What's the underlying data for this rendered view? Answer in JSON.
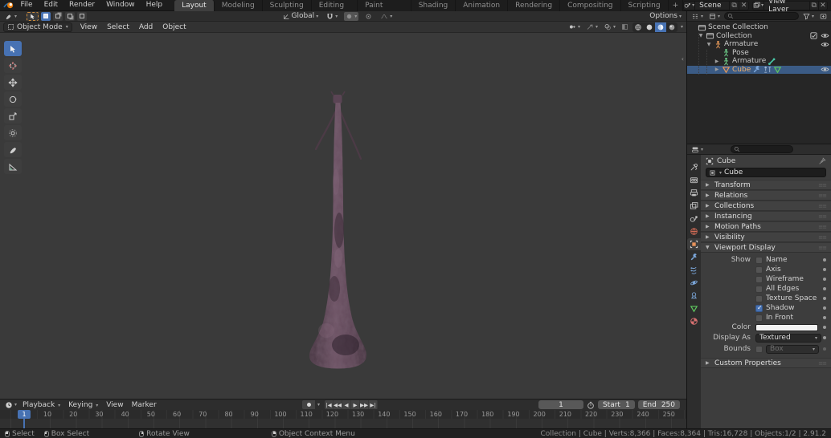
{
  "topbar": {
    "menus": [
      "File",
      "Edit",
      "Render",
      "Window",
      "Help"
    ],
    "tabs": [
      "Layout",
      "Modeling",
      "Sculpting",
      "UV Editing",
      "Texture Paint",
      "Shading",
      "Animation",
      "Rendering",
      "Compositing",
      "Scripting"
    ],
    "active_tab": "Layout",
    "new_tab_label": "+",
    "scene": {
      "label": "Scene"
    },
    "view_layer": {
      "label": "View Layer"
    }
  },
  "tool_settings": {
    "orientation": "Global",
    "options_label": "Options"
  },
  "viewport_header": {
    "mode": "Object Mode",
    "menus": [
      "View",
      "Select",
      "Add",
      "Object"
    ]
  },
  "outliner": {
    "rows": [
      {
        "label": "Scene Collection",
        "depth": 0,
        "arrow": "",
        "icon": "collection",
        "icon_color": "#c9c9c9",
        "right": []
      },
      {
        "label": "Collection",
        "depth": 1,
        "arrow": "down",
        "icon": "collection",
        "icon_color": "#c9c9c9",
        "right": [
          "checkbox",
          "eye"
        ]
      },
      {
        "label": "Armature",
        "depth": 2,
        "arrow": "down",
        "icon": "armature",
        "icon_color": "#e89a5a",
        "right": [
          "eye"
        ]
      },
      {
        "label": "Pose",
        "depth": 3,
        "arrow": "",
        "icon": "pose",
        "icon_color": "#6fd08a",
        "right": []
      },
      {
        "label": "Armature",
        "depth": 3,
        "arrow": "right",
        "icon": "armature",
        "icon_color": "#6fd08a",
        "trailing": [
          "bone"
        ],
        "right": []
      },
      {
        "label": "Cube",
        "depth": 3,
        "arrow": "right",
        "icon": "mesh",
        "icon_color": "#e89a5a",
        "label_color": "#f2b06a",
        "selected": true,
        "trailing": [
          "wrench",
          "armature-mod",
          "mesh-data"
        ],
        "right": [
          "eye"
        ]
      }
    ]
  },
  "properties": {
    "breadcrumb": "Cube",
    "name_value": "Cube",
    "tabs": [
      "tool",
      "render",
      "output",
      "view-layer",
      "scene",
      "world",
      "object",
      "modifiers",
      "particles",
      "physics",
      "constraints",
      "data",
      "material"
    ],
    "active_tab": "object",
    "collapsed_panels": [
      "Transform",
      "Relations",
      "Collections",
      "Instancing",
      "Motion Paths",
      "Visibility"
    ],
    "viewport_display": {
      "title": "Viewport Display",
      "show_label": "Show",
      "show_rows": [
        {
          "label": "Name",
          "checked": false
        },
        {
          "label": "Axis",
          "checked": false
        },
        {
          "label": "Wireframe",
          "checked": false
        },
        {
          "label": "All Edges",
          "checked": false
        },
        {
          "label": "Texture Space",
          "checked": false
        },
        {
          "label": "Shadow",
          "checked": true
        },
        {
          "label": "In Front",
          "checked": false
        }
      ],
      "color_label": "Color",
      "display_as_label": "Display As",
      "display_as_value": "Textured",
      "bounds_label": "Bounds",
      "bounds_value": "Box"
    },
    "bottom_panels": [
      "Custom Properties"
    ]
  },
  "timeline": {
    "menus": [
      "Playback",
      "Keying",
      "View",
      "Marker"
    ],
    "current_frame": "1",
    "start_label": "Start",
    "start_value": "1",
    "end_label": "End",
    "end_value": "250",
    "playhead_frame": "1",
    "ticks": [
      10,
      20,
      30,
      40,
      50,
      60,
      70,
      80,
      90,
      100,
      110,
      120,
      130,
      140,
      150,
      160,
      170,
      180,
      190,
      200,
      210,
      220,
      230,
      240,
      250
    ]
  },
  "statusbar": {
    "hints": [
      {
        "mouse": "left",
        "label": "Select"
      },
      {
        "mouse": "left",
        "label": "Box Select"
      },
      {
        "mouse": "mid",
        "label": "Rotate View"
      },
      {
        "mouse": "right",
        "label": "Object Context Menu"
      }
    ],
    "stats": "Collection | Cube | Verts:8,366 | Faces:8,364 | Tris:16,728 | Objects:1/2 | 2.91.2"
  },
  "colors": {
    "accent": "#4772b3",
    "selection_row": "#3b5b85",
    "active_object": "#f2b06a",
    "viewport_bg": "#3a3a3a"
  }
}
